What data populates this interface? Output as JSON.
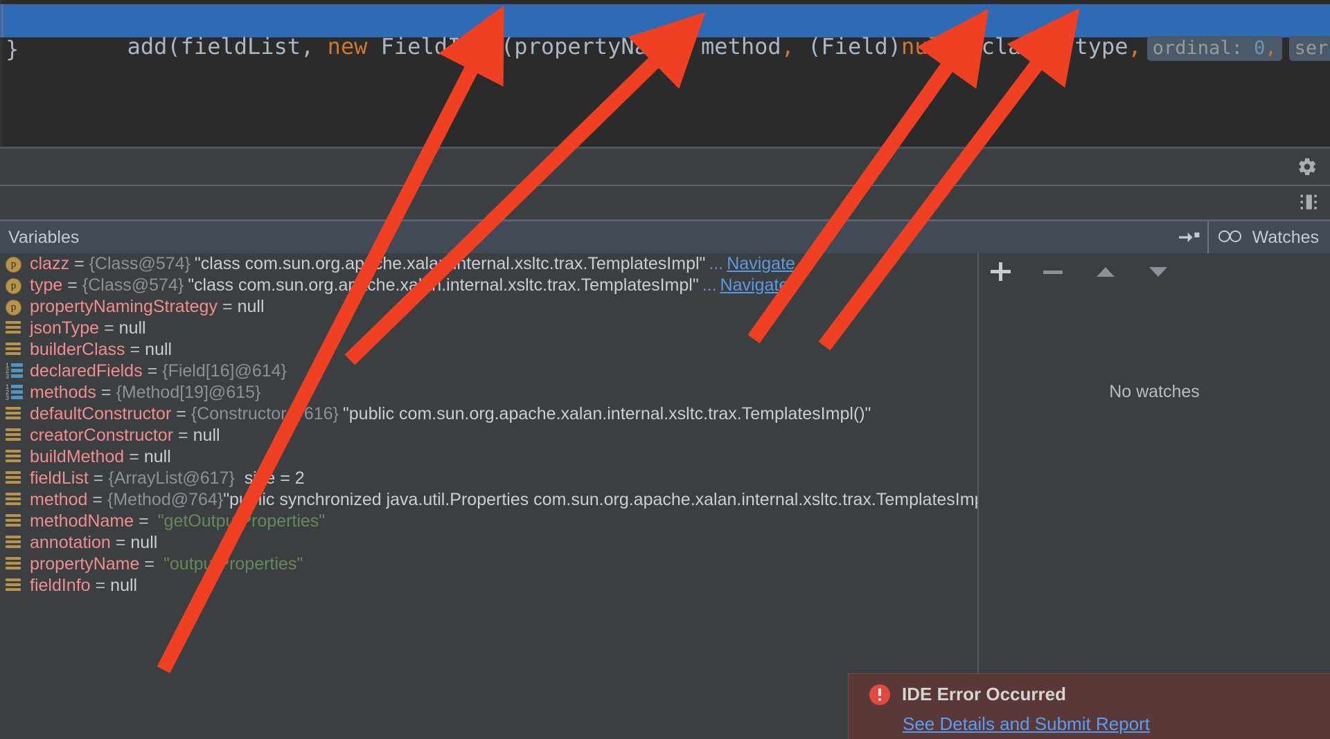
{
  "editor": {
    "code_line_segments": [
      {
        "text": "add(fieldList, ",
        "cls": "plain"
      },
      {
        "text": "new",
        "cls": "kw"
      },
      {
        "text": " FieldInfo(propertyName",
        "cls": "plain"
      },
      {
        "text": ",",
        "cls": "punct-orange"
      },
      {
        "text": " method",
        "cls": "plain"
      },
      {
        "text": ",",
        "cls": "punct-orange"
      },
      {
        "text": " (Field)",
        "cls": "plain"
      },
      {
        "text": "null",
        "cls": "kw"
      },
      {
        "text": ",",
        "cls": "punct-orange"
      },
      {
        "text": " clazz",
        "cls": "plain"
      },
      {
        "text": ",",
        "cls": "punct-orange"
      },
      {
        "text": " type",
        "cls": "plain"
      },
      {
        "text": ",",
        "cls": "punct-orange"
      }
    ],
    "code_line_plain": "add(fieldList, new FieldInfo(propertyName, method, (Field)null, clazz, type,",
    "hint_ordinal_label": "ordinal:",
    "hint_ordinal_value": "0",
    "hint_ordinal_comma": ",",
    "hint_serial_label": "serial",
    "closing_brace": "}"
  },
  "toolbar": {
    "gear_icon": "gear-icon",
    "layout_icon": "layout-settings-icon"
  },
  "variables_panel": {
    "title": "Variables",
    "pin_icon": "pin-tab-icon",
    "watches_tab_label": "Watches",
    "watches_tab_icon": "glasses-icon",
    "rows": [
      {
        "icon": "param",
        "name": "clazz",
        "eq": "=",
        "ref": "{Class@574}",
        "value": "\"class com.sun.org.apache.xalan.internal.xsltc.trax.TemplatesImpl\"",
        "value_kind": "text",
        "ellipsis": "...",
        "navigate": "Navigate"
      },
      {
        "icon": "param",
        "name": "type",
        "eq": "=",
        "ref": "{Class@574}",
        "value": "\"class com.sun.org.apache.xalan.internal.xsltc.trax.TemplatesImpl\"",
        "value_kind": "text",
        "ellipsis": "...",
        "navigate": "Navigate"
      },
      {
        "icon": "param",
        "name": "propertyNamingStrategy",
        "eq": "=",
        "ref": "",
        "value": "null",
        "value_kind": "null"
      },
      {
        "icon": "field",
        "name": "jsonType",
        "eq": "=",
        "ref": "",
        "value": "null",
        "value_kind": "null"
      },
      {
        "icon": "field",
        "name": "builderClass",
        "eq": "=",
        "ref": "",
        "value": "null",
        "value_kind": "null"
      },
      {
        "icon": "array",
        "name": "declaredFields",
        "eq": "=",
        "ref": "{Field[16]@614}",
        "value": "",
        "value_kind": "none"
      },
      {
        "icon": "array",
        "name": "methods",
        "eq": "=",
        "ref": "{Method[19]@615}",
        "value": "",
        "value_kind": "none"
      },
      {
        "icon": "field",
        "name": "defaultConstructor",
        "eq": "=",
        "ref": "{Constructor@616}",
        "value": "\"public com.sun.org.apache.xalan.internal.xsltc.trax.TemplatesImpl()\"",
        "value_kind": "text"
      },
      {
        "icon": "field",
        "name": "creatorConstructor",
        "eq": "=",
        "ref": "",
        "value": "null",
        "value_kind": "null"
      },
      {
        "icon": "field",
        "name": "buildMethod",
        "eq": "=",
        "ref": "",
        "value": "null",
        "value_kind": "null"
      },
      {
        "icon": "field",
        "name": "fieldList",
        "eq": "=",
        "ref": "{ArrayList@617}",
        "value": "size = 2",
        "value_kind": "size"
      },
      {
        "icon": "field",
        "name": "method",
        "eq": "=",
        "ref": "{Method@764}",
        "value": "\"public synchronized java.util.Properties com.sun.org.apache.xalan.internal.xsltc.trax.TemplatesImpl.getOutput",
        "value_kind": "text"
      },
      {
        "icon": "field",
        "name": "methodName",
        "eq": "=",
        "ref": "",
        "value": "\"getOutputProperties\"",
        "value_kind": "string"
      },
      {
        "icon": "field",
        "name": "annotation",
        "eq": "=",
        "ref": "",
        "value": "null",
        "value_kind": "null"
      },
      {
        "icon": "field",
        "name": "propertyName",
        "eq": "=",
        "ref": "",
        "value": "\"outputProperties\"",
        "value_kind": "string"
      },
      {
        "icon": "field",
        "name": "fieldInfo",
        "eq": "=",
        "ref": "",
        "value": "null",
        "value_kind": "null"
      }
    ]
  },
  "watches_panel": {
    "empty_text": "No watches",
    "buttons": [
      {
        "name": "add-watch-button",
        "glyph": "+"
      },
      {
        "name": "remove-watch-button",
        "glyph": "−"
      },
      {
        "name": "move-watch-up-button",
        "glyph": "▲"
      },
      {
        "name": "move-watch-down-button",
        "glyph": "▼"
      }
    ]
  },
  "notification": {
    "title": "IDE Error Occurred",
    "link": "See Details and Submit Report",
    "icon": "error-icon"
  },
  "annotations": {
    "arrow_color": "#ef4023",
    "arrow_count": 4,
    "targets": [
      "propertyName",
      "method",
      "clazz",
      "type"
    ]
  },
  "colors": {
    "editor_bg": "#2b2b2b",
    "panel_bg": "#3c3f41",
    "selection_blue": "#2f6ab5",
    "header_bg": "#414a56",
    "var_name": "#f08d8d",
    "string_green": "#6a8759",
    "keyword_orange": "#cc7832",
    "link_blue": "#589df6",
    "error_bg": "#5a3838"
  }
}
